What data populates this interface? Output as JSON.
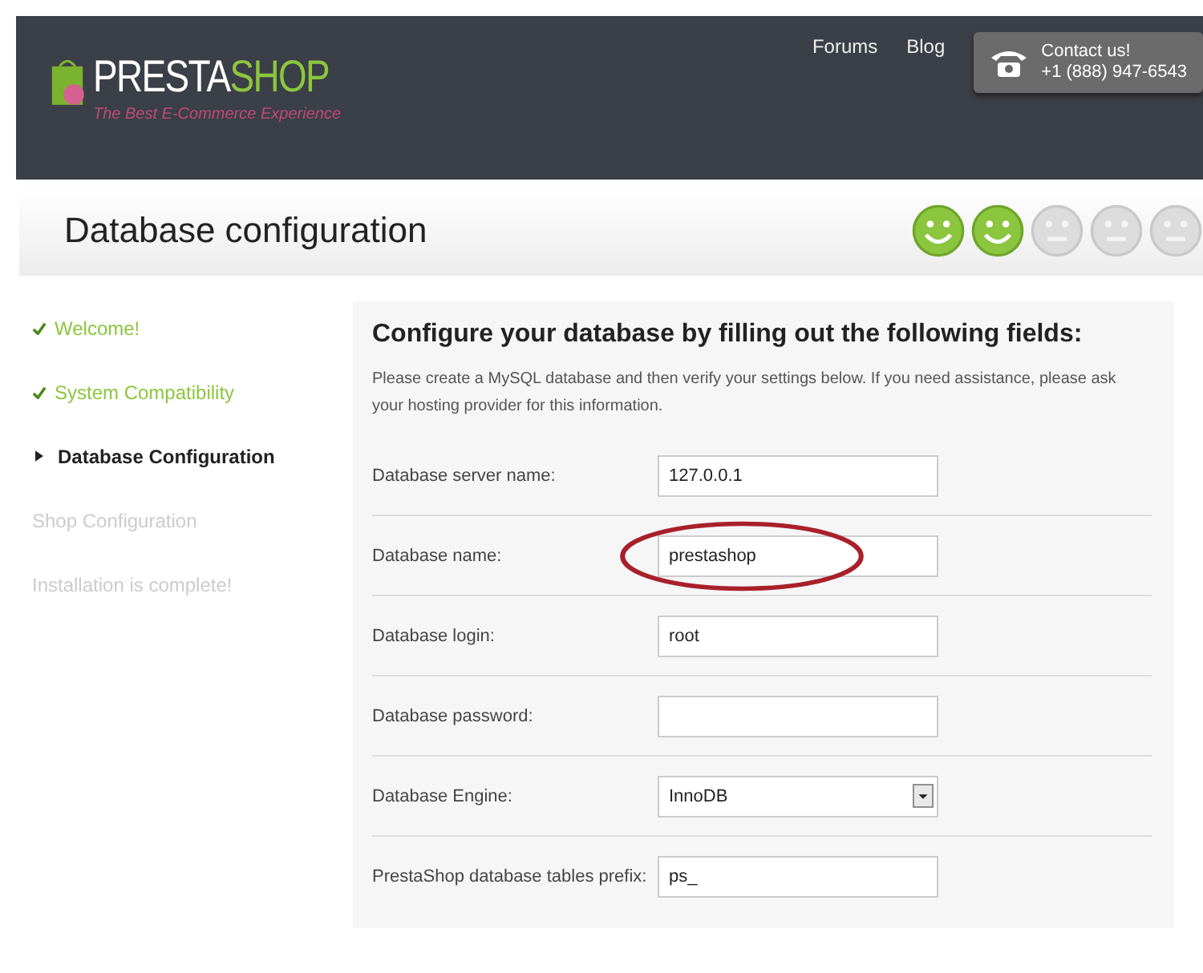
{
  "header": {
    "logo": {
      "part_1": "PRESTA",
      "part_2": "SHOP",
      "tagline": "The Best E-Commerce Experience"
    },
    "links": [
      "Forums",
      "Blog"
    ],
    "contact": {
      "title": "Contact us!",
      "phone": "+1 (888) 947-6543"
    }
  },
  "page_title": "Database configuration",
  "progress": [
    {
      "done": true
    },
    {
      "done": true
    },
    {
      "done": false
    },
    {
      "done": false
    },
    {
      "done": false
    }
  ],
  "steps": [
    {
      "label": "Welcome!",
      "done": true,
      "selected": false
    },
    {
      "label": "System Compatibility",
      "done": true,
      "selected": false
    },
    {
      "label": "Database Configuration",
      "done": false,
      "selected": true
    },
    {
      "label": "Shop Configuration",
      "done": false,
      "selected": false
    },
    {
      "label": "Installation is complete!",
      "done": false,
      "selected": false
    }
  ],
  "form": {
    "heading": "Configure your database by filling out the following fields:",
    "intro": "Please create a MySQL database and then verify your settings below. If you need assistance, please ask your hosting provider for this information.",
    "fields": [
      {
        "label": "Database server name:",
        "kind": "text",
        "value": "127.0.0.1",
        "circled": false
      },
      {
        "label": "Database name:",
        "kind": "text",
        "value": "prestashop",
        "circled": true
      },
      {
        "label": "Database login:",
        "kind": "text",
        "value": "root",
        "circled": false
      },
      {
        "label": "Database password:",
        "kind": "text",
        "circled": false
      },
      {
        "label": "Database Engine:",
        "kind": "select",
        "value": "InnoDB",
        "circled": false
      },
      {
        "label": "PrestaShop database tables prefix:",
        "kind": "text",
        "value": "ps_",
        "circled": false
      }
    ]
  }
}
